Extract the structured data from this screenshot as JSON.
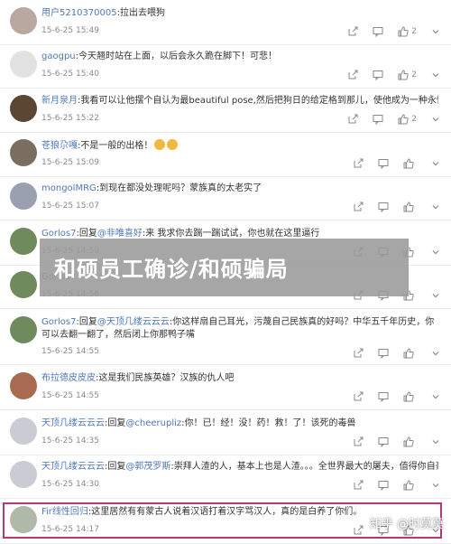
{
  "comments": [
    {
      "user": "用户5210370005",
      "mention": "",
      "sep": "",
      "text": "拉出去喂狗",
      "time": "15-6-25 15:49",
      "likes": "2",
      "avatar_color": "#b9a8a0"
    },
    {
      "user": "gaogpu",
      "mention": "",
      "sep": "",
      "text": "今天翘时站在上面，以后会永久跪在脚下！可悲！",
      "time": "15-6-25 15:40",
      "likes": "2",
      "avatar_color": "#e2e2e2"
    },
    {
      "user": "新月泉月",
      "mention": "",
      "sep": "",
      "text": "我看可以让他摆个自认为最beautiful pose,然后把狗日的给定格到那儿，使他成为一种永恒",
      "time": "15-6-25 15:22",
      "likes": "2",
      "avatar_color": "#5a4632"
    },
    {
      "user": "苍狼尕嘎",
      "mention": "",
      "sep": "",
      "text": "不是一般的出格！",
      "time": "15-6-25 15:09",
      "likes": "",
      "avatar_color": "#7a6e60"
    },
    {
      "user": "mongolMRG",
      "mention": "",
      "sep": "",
      "text": "到现在都没处理呢吗？蒙族真的太老实了",
      "time": "15-6-25 15:07",
      "likes": "",
      "avatar_color": "#9aa0b0"
    },
    {
      "user": "Gorlos7",
      "mention": "@非唯喜好",
      "sep": "回复",
      "text": ":来 我求你去踹一踹试试，你也就在这里逼行",
      "time": "15-6-25 14:59",
      "likes": "",
      "avatar_color": "#6f8a5c"
    },
    {
      "user": "Gorlos7",
      "mention": "",
      "sep": "",
      "text": "",
      "time": "15-6-25 14:56",
      "likes": "",
      "avatar_color": "#6f8a5c"
    },
    {
      "user": "Gorlos7",
      "mention": "@天顶几缕云云云",
      "sep": "回复",
      "text": ":你这样扇自己耳光，污蔑自己民族真的好吗？中华五千年历史，你可以去翻一翻了，然后闭上你那鸭子嘴",
      "time": "15-6-25 14:55",
      "likes": "",
      "avatar_color": "#6f8a5c"
    },
    {
      "user": "布拉德皮皮皮",
      "mention": "",
      "sep": "",
      "text": "这是我们民族英雄？汉族的仇人吧",
      "time": "15-6-25 14:55",
      "likes": "",
      "avatar_color": "#a86a50"
    },
    {
      "user": "天顶几缕云云云",
      "mention": "@cheerupliz",
      "sep": "回复",
      "text": ":你！已！经！没！药！救！了！该死的毒兽",
      "time": "15-6-25 14:35",
      "likes": "",
      "avatar_color": "#c9ccd2"
    },
    {
      "user": "天顶几缕云云云",
      "mention": "@郭茂罗斯",
      "sep": "回复",
      "text": ":崇拜人渣的人，基本上也是人渣。。。全世界最大的屠夫，值得你自豪吗！",
      "time": "15-6-25 14:30",
      "likes": "",
      "avatar_color": "#c9ccd2"
    },
    {
      "user": "Fir线性回归",
      "mention": "",
      "sep": "",
      "text": "这里居然有有蒙古人说着汉语打着汉字骂汉人，真的是白养了你们。",
      "time": "15-6-25 14:17",
      "likes": "",
      "avatar_color": "#b0b8a8"
    }
  ],
  "overlay_title": "和硕员工确诊/和硕骗局",
  "watermark": "知乎 @时莫莫",
  "colors": {
    "accent": "#4f78b8",
    "highlight": "#b8377a"
  },
  "icons": [
    "share-icon",
    "comment-icon",
    "like-icon"
  ]
}
